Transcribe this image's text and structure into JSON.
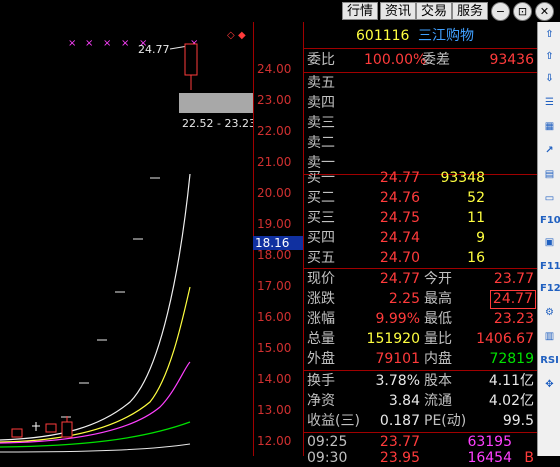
{
  "toolbar": {
    "buttons": [
      "行情",
      "资讯",
      "交易",
      "服务"
    ],
    "win_buttons": [
      "−",
      "⊡",
      "✕"
    ]
  },
  "chart": {
    "ticks": [
      "24.00",
      "23.00",
      "22.00",
      "21.00",
      "20.00",
      "19.00",
      "18.00",
      "17.00",
      "16.00",
      "15.00",
      "14.00",
      "13.00",
      "12.00"
    ],
    "high_label": "24.77",
    "range_label": "22.52 - 23.23",
    "cursor_value": "18.16"
  },
  "quote": {
    "code": "601116",
    "name": "三江购物",
    "weibi_label": "委比",
    "weibi_value": "100.00%",
    "weicha_label": "委差",
    "weicha_value": "93436",
    "asks": [
      {
        "label": "卖五",
        "price": "",
        "vol": ""
      },
      {
        "label": "卖四",
        "price": "",
        "vol": ""
      },
      {
        "label": "卖三",
        "price": "",
        "vol": ""
      },
      {
        "label": "卖二",
        "price": "",
        "vol": ""
      },
      {
        "label": "卖一",
        "price": "",
        "vol": ""
      }
    ],
    "bids": [
      {
        "label": "买一",
        "price": "24.77",
        "vol": "93348"
      },
      {
        "label": "买二",
        "price": "24.76",
        "vol": "52"
      },
      {
        "label": "买三",
        "price": "24.75",
        "vol": "11"
      },
      {
        "label": "买四",
        "price": "24.74",
        "vol": "9"
      },
      {
        "label": "买五",
        "price": "24.70",
        "vol": "16"
      }
    ],
    "stats": [
      {
        "l1": "现价",
        "v1": "24.77",
        "l2": "今开",
        "v2": "23.77"
      },
      {
        "l1": "涨跌",
        "v1": "2.25",
        "l2": "最高",
        "v2": "24.77"
      },
      {
        "l1": "涨幅",
        "v1": "9.99%",
        "l2": "最低",
        "v2": "23.23"
      },
      {
        "l1": "总量",
        "v1": "151920",
        "l2": "量比",
        "v2": "1406.67"
      },
      {
        "l1": "外盘",
        "v1": "79101",
        "l2": "内盘",
        "v2": "72819"
      }
    ],
    "info": [
      {
        "l1": "换手",
        "v1": "3.78%",
        "l2": "股本",
        "v2": "4.11亿"
      },
      {
        "l1": "净资",
        "v1": "3.84",
        "l2": "流通",
        "v2": "4.02亿"
      },
      {
        "l1": "收益(三)",
        "v1": "0.187",
        "l2": "PE(动)",
        "v2": "99.5"
      }
    ],
    "ticks": [
      {
        "time": "09:25",
        "price": "23.77",
        "vol": "63195",
        "flag": ""
      },
      {
        "time": "09:30",
        "price": "23.95",
        "vol": "16454",
        "flag": "B"
      }
    ]
  },
  "sidebar": {
    "icons": [
      "up-arrow-icon",
      "up-arrow-outline-icon",
      "down-arrow-outline-icon",
      "list-icon",
      "grid-icon",
      "trend-icon",
      "doc-icon",
      "card-icon",
      "F10",
      "F10-alt",
      "F11",
      "F12",
      "gear-icon",
      "volume-icon",
      "RSI",
      "move-icon"
    ]
  },
  "colors": {
    "up": "#ff3b3b",
    "down": "#00e000",
    "volume": "#ffff40",
    "axis": "#a00000"
  }
}
